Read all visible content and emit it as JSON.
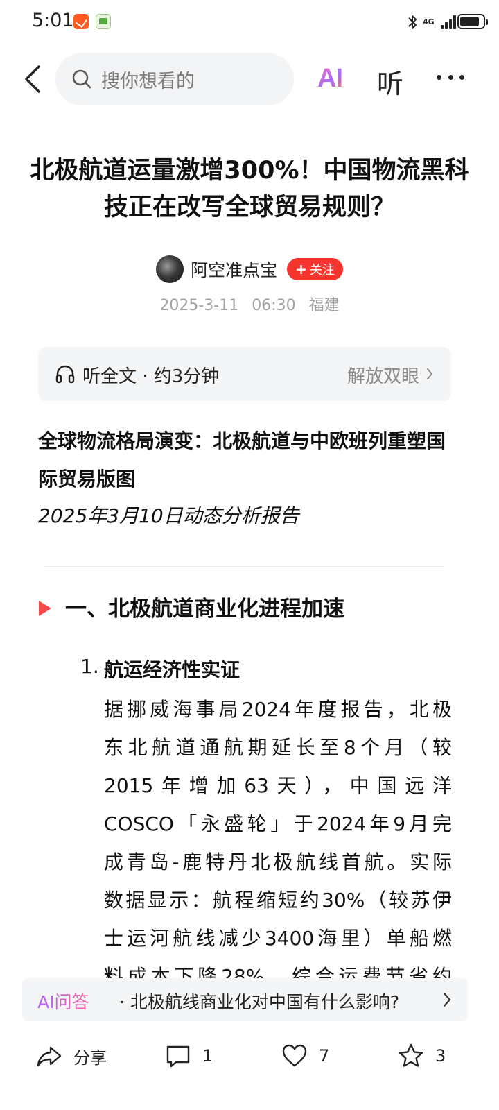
{
  "status_bar": {
    "time": "5:01",
    "network": "4G",
    "icons": [
      "app-notification-icon",
      "app-notification-icon-2",
      "bluetooth-icon",
      "signal-icon",
      "battery-icon"
    ],
    "battery_level": 0.85
  },
  "nav": {
    "search_placeholder": "搜你想看的",
    "ai_label": "AI",
    "listen_label": "听"
  },
  "article": {
    "title": "北极航道运量激增300%！中国物流黑科技正在改写全球贸易规则？",
    "author": "阿空准点宝",
    "follow_label": "关注",
    "date": "2025-3-11",
    "time": "06:30",
    "location": "福建",
    "listen_card": {
      "left": "听全文 · 约3分钟",
      "right": "解放双眼"
    },
    "heading": "全球物流格局演变：北极航道与中欧班列重塑国际贸易版图",
    "report_date": "2025年3月10日动态分析报告",
    "section_title": "一、北极航道商业化进程加速",
    "list_number": "1.",
    "list_title": "航运经济性实证",
    "body_lines": [
      "据挪威海事局2024年度报告，北极",
      "东北航道通航期延长至8个月（较",
      "2015年增加63天），中国远洋",
      "COSCO「永盛轮」于2024年9月完",
      "成青岛-鹿特丹北极航线首航。实际",
      "数据显示：航程缩短约30%（较苏伊",
      "士运河航线减少3400海里）单船燃",
      "料成本下降28%，综合运费节省约"
    ]
  },
  "ai_qa": {
    "tag": "AI问答",
    "question": "· 北极航线商业化对中国有什么影响?"
  },
  "bottom_bar": {
    "share_label": "分享",
    "comment_count": "1",
    "like_count": "7",
    "favorite_count": "3"
  },
  "colors": {
    "accent_red": "#f5352e",
    "section_marker": "#f54b4b",
    "meta_gray": "#a3a3a3"
  }
}
